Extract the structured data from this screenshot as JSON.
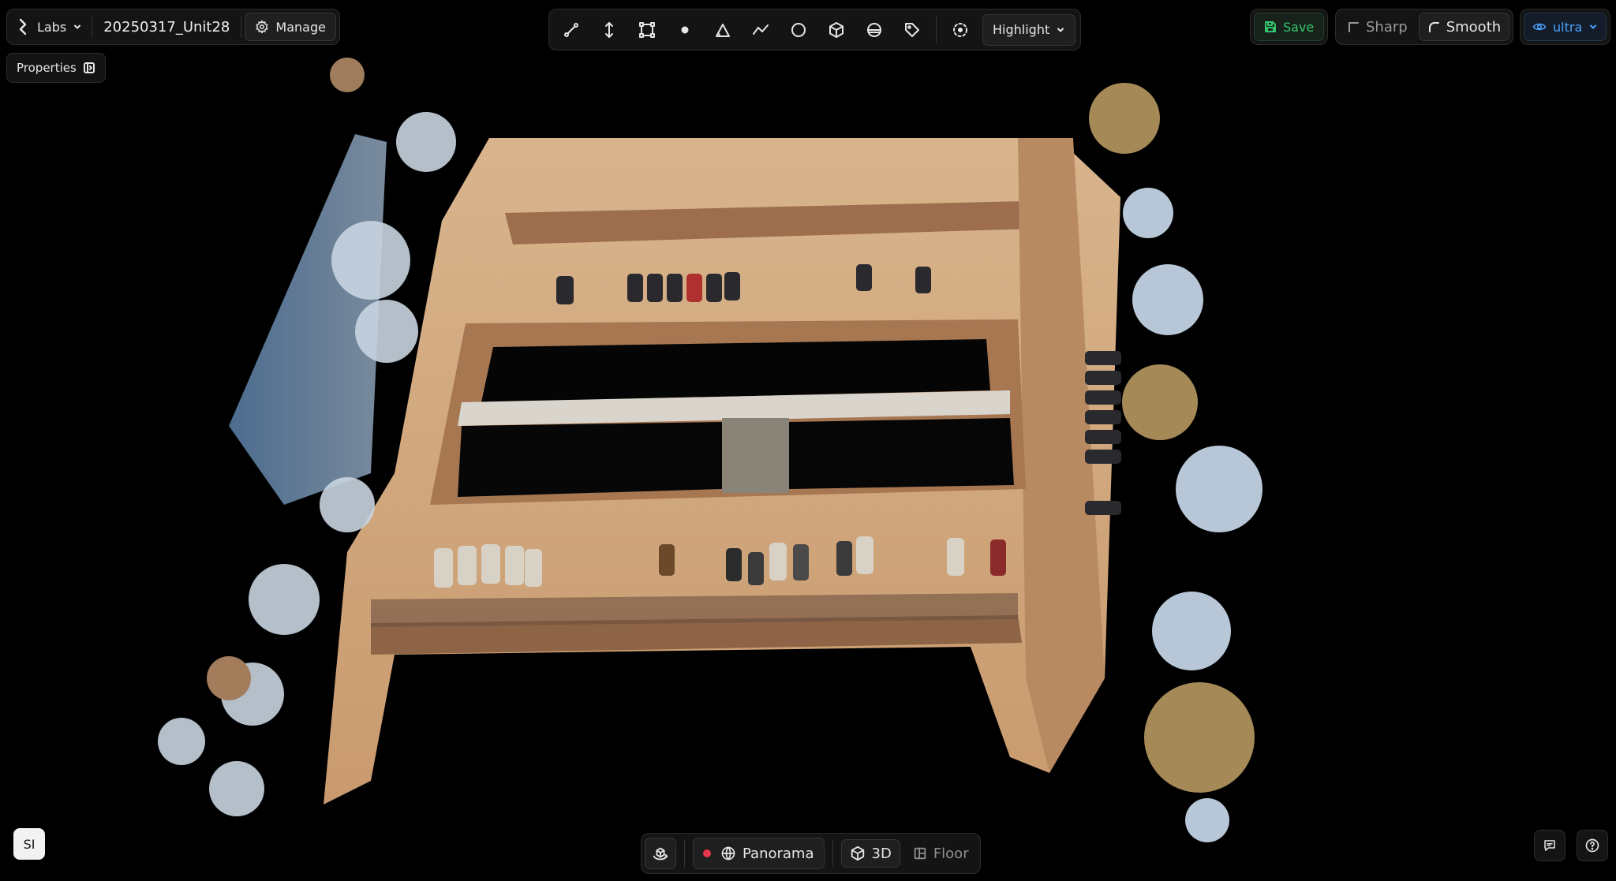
{
  "header": {
    "workspace_label": "Labs",
    "project_name": "20250317_Unit28",
    "manage_label": "Manage",
    "properties_label": "Properties"
  },
  "tools": [
    {
      "id": "line",
      "icon": "line-measure-icon"
    },
    {
      "id": "height",
      "icon": "vertical-measure-icon"
    },
    {
      "id": "area-rect",
      "icon": "rectangle-area-icon"
    },
    {
      "id": "point",
      "icon": "point-icon"
    },
    {
      "id": "angle",
      "icon": "angle-icon"
    },
    {
      "id": "polyline",
      "icon": "polyline-icon"
    },
    {
      "id": "circle",
      "icon": "circle-icon"
    },
    {
      "id": "volume",
      "icon": "cube-volume-icon"
    },
    {
      "id": "section",
      "icon": "sphere-section-icon"
    },
    {
      "id": "tag",
      "icon": "tag-icon"
    },
    {
      "id": "focus",
      "icon": "focus-target-icon"
    }
  ],
  "highlight_label": "Highlight",
  "save_label": "Save",
  "render_modes": {
    "sharp_label": "Sharp",
    "smooth_label": "Smooth",
    "active": "Smooth"
  },
  "quality_label": "ultra",
  "bottom": {
    "panorama_label": "Panorama",
    "view_3d_label": "3D",
    "floor_label": "Floor",
    "active_view": "3D"
  },
  "user_initials": "SI",
  "colors": {
    "save_green": "#34c46e",
    "quality_blue": "#4aa3ff",
    "record_red": "#e8374a"
  }
}
